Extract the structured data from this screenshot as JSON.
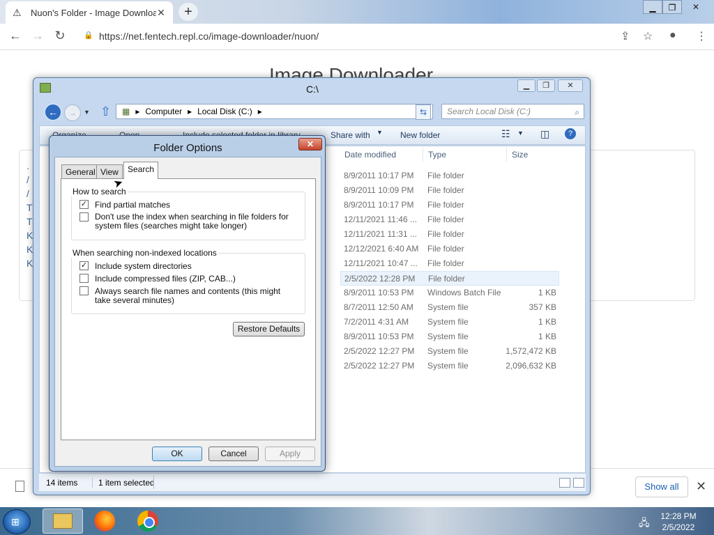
{
  "browser": {
    "tab_title": "Nuon's Folder - Image Downloa",
    "url": "https://net.fentech.repl.co/image-downloader/nuon/"
  },
  "page": {
    "title": "Image Downloader",
    "show_all": "Show all"
  },
  "explorer": {
    "title": "C:\\",
    "breadcrumb": [
      "Computer",
      "Local Disk (C:)"
    ],
    "search_placeholder": "Search Local Disk (C:)",
    "toolbar": {
      "organize": "Organize",
      "open": "Open",
      "include": "Include selected folder in library",
      "share": "Share with",
      "new_folder": "New folder"
    },
    "columns": {
      "date": "Date modified",
      "type": "Type",
      "size": "Size"
    },
    "files": [
      {
        "date": "8/9/2011 10:17 PM",
        "type": "File folder",
        "size": ""
      },
      {
        "date": "8/9/2011 10:09 PM",
        "type": "File folder",
        "size": ""
      },
      {
        "date": "8/9/2011 10:17 PM",
        "type": "File folder",
        "size": ""
      },
      {
        "date": "12/11/2021 11:46 ...",
        "type": "File folder",
        "size": ""
      },
      {
        "date": "12/11/2021 11:31 ...",
        "type": "File folder",
        "size": ""
      },
      {
        "date": "12/12/2021 6:40 AM",
        "type": "File folder",
        "size": ""
      },
      {
        "date": "12/11/2021 10:47 ...",
        "type": "File folder",
        "size": ""
      },
      {
        "date": "2/5/2022 12:28 PM",
        "type": "File folder",
        "size": ""
      },
      {
        "date": "8/9/2011 10:53 PM",
        "type": "Windows Batch File",
        "size": "1 KB"
      },
      {
        "date": "8/7/2011 12:50 AM",
        "type": "System file",
        "size": "357 KB"
      },
      {
        "date": "7/2/2011 4:31 AM",
        "type": "System file",
        "size": "1 KB"
      },
      {
        "date": "8/9/2011 10:53 PM",
        "type": "System file",
        "size": "1 KB"
      },
      {
        "date": "2/5/2022 12:27 PM",
        "type": "System file",
        "size": "1,572,472 KB"
      },
      {
        "date": "2/5/2022 12:27 PM",
        "type": "System file",
        "size": "2,096,632 KB"
      }
    ],
    "status": {
      "count": "14 items",
      "selected": "1 item selected"
    }
  },
  "dialog": {
    "title": "Folder Options",
    "tabs": [
      "General",
      "View",
      "Search"
    ],
    "active_tab": "Search",
    "how_to_search": {
      "label": "How to search",
      "find_partial": "Find partial matches",
      "find_partial_checked": true,
      "dont_use_index": "Don't use the index when searching in file folders for system files (searches might take longer)",
      "dont_use_index_checked": false
    },
    "non_indexed": {
      "label": "When searching non-indexed locations",
      "system_dirs": "Include system directories",
      "system_dirs_checked": true,
      "compressed": "Include compressed files (ZIP, CAB...)",
      "compressed_checked": false,
      "always_contents": "Always search file names and contents (this might take several minutes)",
      "always_contents_checked": false
    },
    "restore_defaults": "Restore Defaults",
    "ok": "OK",
    "cancel": "Cancel",
    "apply": "Apply"
  },
  "taskbar": {
    "time": "12:28 PM",
    "date": "2/5/2022"
  }
}
